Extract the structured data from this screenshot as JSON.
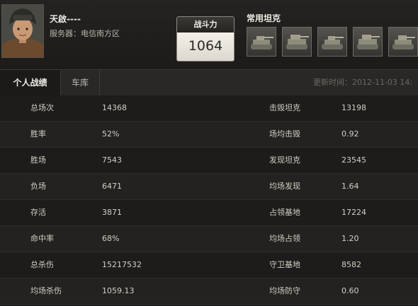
{
  "header": {
    "player_name": "天啟----",
    "server_label": "服务器：",
    "server_value": "电信南方区",
    "power_title": "战斗力",
    "power_value": "1064",
    "tanks_title": "常用坦克"
  },
  "tabs": [
    {
      "label": "个人战绩",
      "active": true
    },
    {
      "label": "车库",
      "active": false
    }
  ],
  "updated_text": "更新时间：2012-11-03 14:",
  "stats": [
    {
      "label1": "总场次",
      "value1": "14368",
      "label2": "击毁坦克",
      "value2": "13198"
    },
    {
      "label1": "胜率",
      "value1": "52%",
      "label2": "场均击毁",
      "value2": "0.92"
    },
    {
      "label1": "胜场",
      "value1": "7543",
      "label2": "发现坦克",
      "value2": "23545"
    },
    {
      "label1": "负场",
      "value1": "6471",
      "label2": "均场发现",
      "value2": "1.64"
    },
    {
      "label1": "存活",
      "value1": "3871",
      "label2": "占领基地",
      "value2": "17224"
    },
    {
      "label1": "命中率",
      "value1": "68%",
      "label2": "均场占领",
      "value2": "1.20"
    },
    {
      "label1": "总杀伤",
      "value1": "15217532",
      "label2": "守卫基地",
      "value2": "8582"
    },
    {
      "label1": "均场杀伤",
      "value1": "1059.13",
      "label2": "均场防守",
      "value2": "0.60"
    }
  ]
}
